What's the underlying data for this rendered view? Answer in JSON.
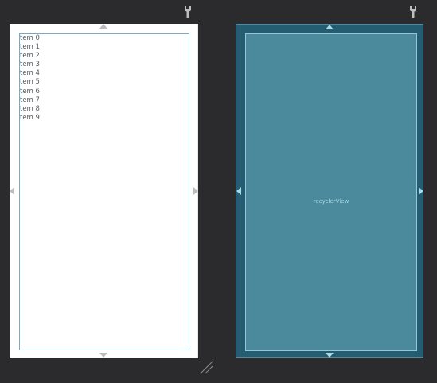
{
  "design": {
    "items": [
      "tem 0",
      "tem 1",
      "tem 2",
      "tem 3",
      "tem 4",
      "tem 5",
      "tem 6",
      "tem 7",
      "tem 8",
      "tem 9"
    ]
  },
  "blueprint": {
    "label": "recyclerView"
  },
  "toolbar": {
    "design_settings_icon": "wrench-icon",
    "blueprint_settings_icon": "wrench-icon"
  },
  "colors": {
    "canvas_bg": "#2b2b2d",
    "blueprint_bg": "#245d72",
    "blueprint_view": "#4a8a9c",
    "view_border": "#7aa9c6"
  }
}
